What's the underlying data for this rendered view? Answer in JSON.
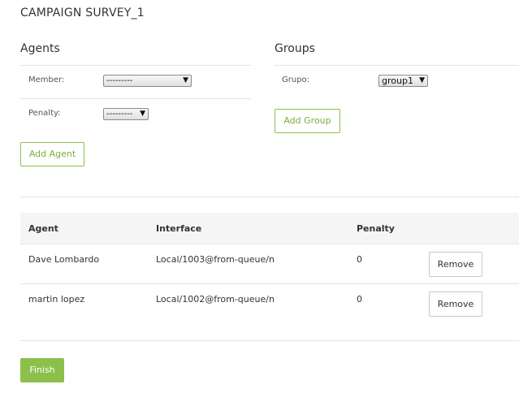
{
  "page": {
    "title": "CAMPAIGN SURVEY_1"
  },
  "agents": {
    "title": "Agents",
    "member_label": "Member:",
    "member_value": "---------",
    "penalty_label": "Penalty:",
    "penalty_value": "---------",
    "add_button": "Add Agent"
  },
  "groups": {
    "title": "Groups",
    "group_label": "Grupo:",
    "group_value": "group1",
    "add_button": "Add Group"
  },
  "table": {
    "headers": {
      "agent": "Agent",
      "interface": "Interface",
      "penalty": "Penalty"
    },
    "rows": [
      {
        "agent": "Dave Lombardo",
        "interface": "Local/1003@from-queue/n",
        "penalty": "0",
        "action": "Remove"
      },
      {
        "agent": "martin lopez",
        "interface": "Local/1002@from-queue/n",
        "penalty": "0",
        "action": "Remove"
      }
    ]
  },
  "footer": {
    "finish_button": "Finish"
  },
  "colors": {
    "accent": "#8cc04b",
    "accent_text": "#7aae3a"
  },
  "icons": {
    "dropdown": "caret-down-icon"
  }
}
